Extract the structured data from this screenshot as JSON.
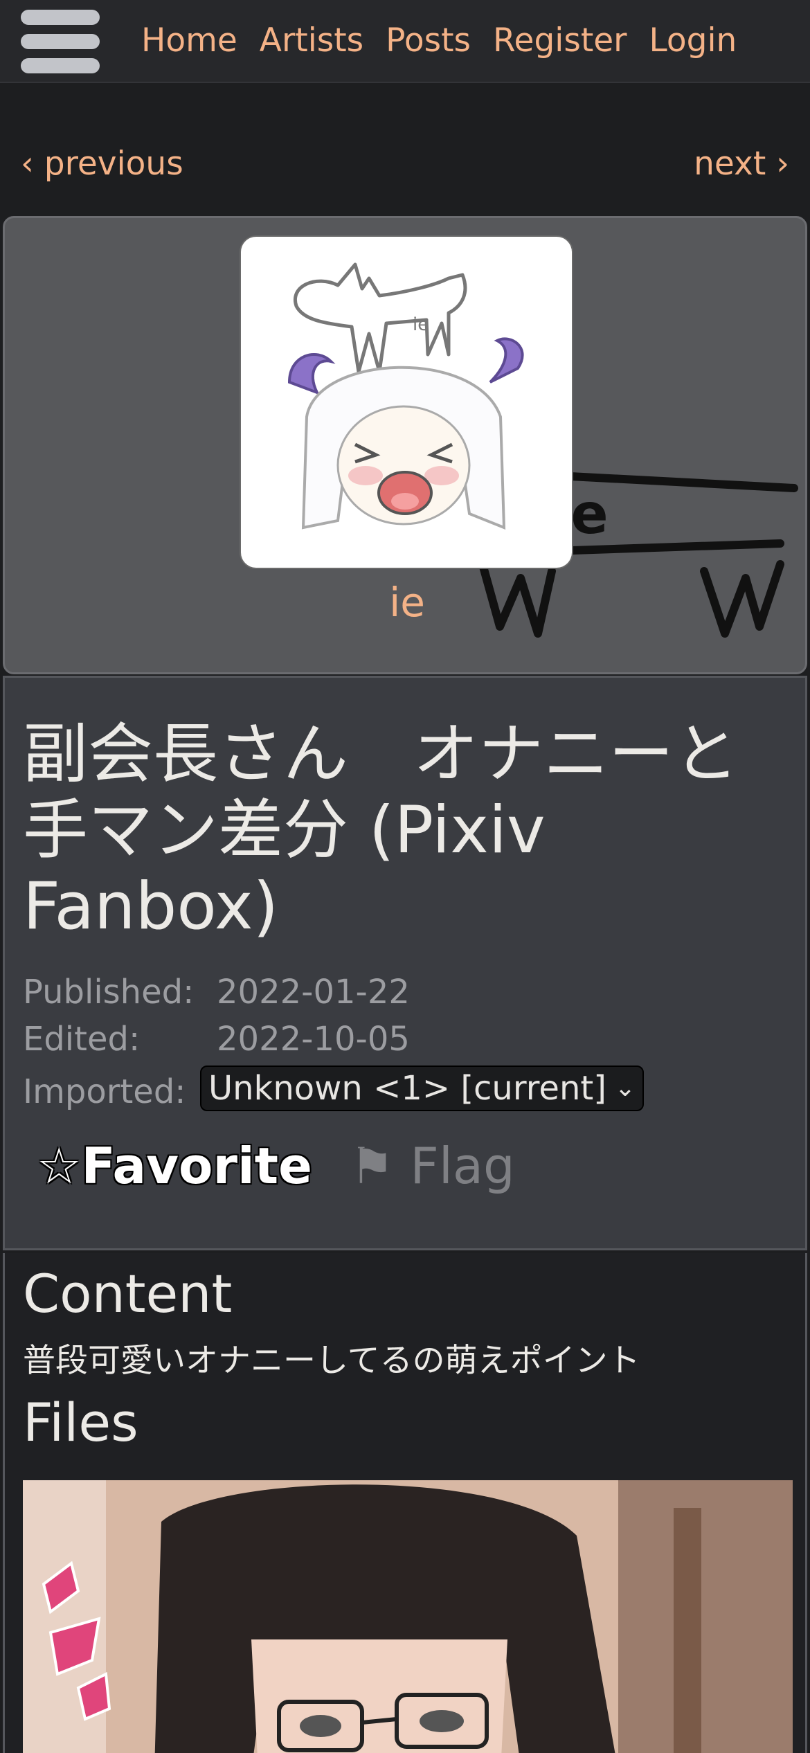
{
  "nav": {
    "links": [
      "Home",
      "Artists",
      "Posts",
      "Register",
      "Login"
    ]
  },
  "pager": {
    "previous": "‹ previous",
    "next": "next ›"
  },
  "user": {
    "name": "ie",
    "avatar_text": "ie",
    "banner_text": "ie"
  },
  "post": {
    "title": "副会長さん　オナニーと手マン差分 (Pixiv Fanbox)",
    "published_label": "Published:",
    "published_value": "2022-01-22",
    "edited_label": "Edited:",
    "edited_value": "2022-10-05",
    "imported_label": "Imported:",
    "imported_selected": "Unknown <1> [current]",
    "favorite_label": "☆Favorite",
    "flag_label": "⚑ Flag"
  },
  "content": {
    "heading": "Content",
    "description": "普段可愛いオナニーしてるの萌えポイント",
    "files_heading": "Files"
  },
  "colors": {
    "link": "#f4b287",
    "background": "#1d1e20",
    "card": "#3a3c41"
  }
}
